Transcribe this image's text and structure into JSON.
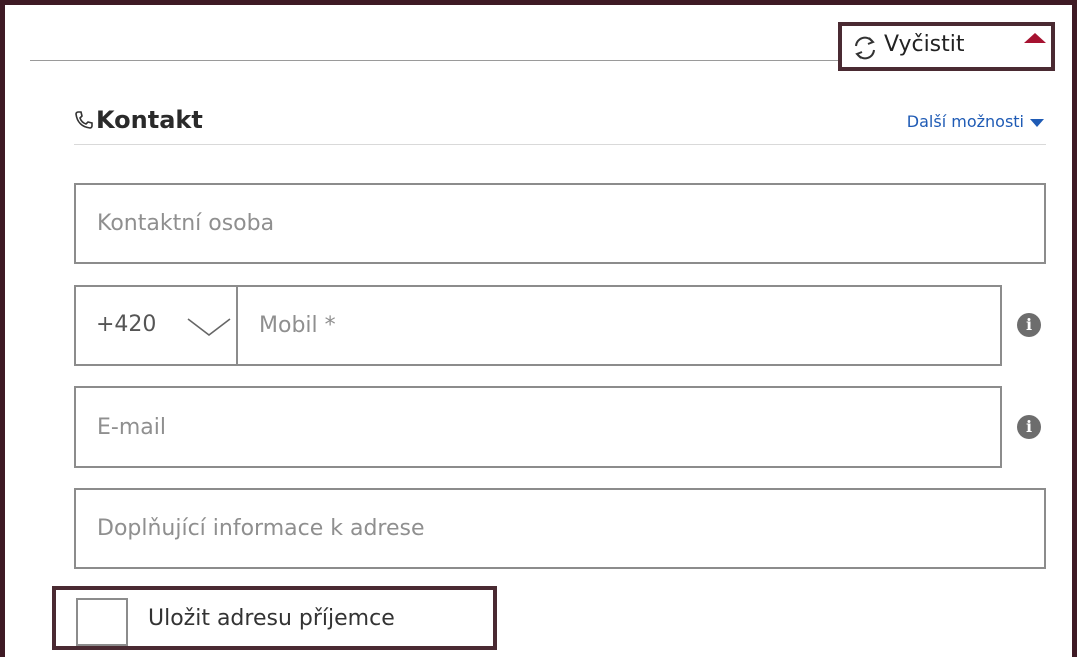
{
  "header": {
    "clear_label": "Vyčistit"
  },
  "section": {
    "title": "Kontakt",
    "more_options_label": "Další možnosti"
  },
  "fields": {
    "contact_person_placeholder": "Kontaktní osoba",
    "phone_prefix_value": "+420",
    "mobile_placeholder": "Mobil *",
    "email_placeholder": "E-mail",
    "address_info_placeholder": "Doplňující informace k adrese"
  },
  "save": {
    "label": "Uložit adresu příjemce",
    "checked": false
  },
  "icons": {
    "clear": "refresh-icon",
    "collapse": "caret-up-icon",
    "section": "phone-icon",
    "more": "caret-down-icon",
    "prefix": "chevron-down-icon",
    "info": "info-icon"
  },
  "colors": {
    "accent_red": "#a61230",
    "link_blue": "#1f5bb5",
    "frame": "#3e1a24"
  }
}
